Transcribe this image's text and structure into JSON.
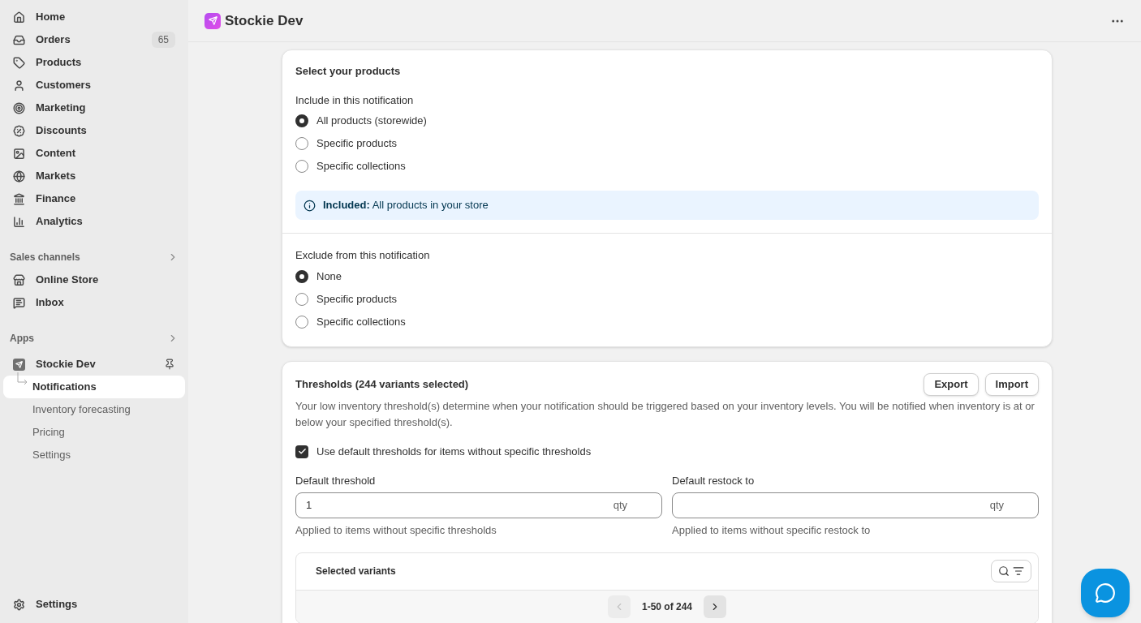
{
  "sidebar": {
    "items": [
      {
        "label": "Home",
        "selected": false
      },
      {
        "label": "Orders",
        "badge": "65",
        "selected": false
      },
      {
        "label": "Products",
        "selected": false
      },
      {
        "label": "Customers",
        "selected": false
      },
      {
        "label": "Marketing",
        "selected": false
      },
      {
        "label": "Discounts",
        "selected": false
      },
      {
        "label": "Content",
        "selected": false
      },
      {
        "label": "Markets",
        "selected": false
      },
      {
        "label": "Finance",
        "selected": false
      },
      {
        "label": "Analytics",
        "selected": false
      }
    ],
    "sales_channels": {
      "heading": "Sales channels",
      "items": [
        {
          "label": "Online Store",
          "selected": false
        },
        {
          "label": "Inbox",
          "selected": false
        }
      ]
    },
    "apps": {
      "heading": "Apps",
      "app": {
        "label": "Stockie Dev",
        "children": [
          {
            "label": "Notifications",
            "selected": true
          },
          {
            "label": "Inventory forecasting",
            "selected": false
          },
          {
            "label": "Pricing",
            "selected": false
          },
          {
            "label": "Settings",
            "selected": false
          }
        ]
      }
    },
    "settings": "Settings"
  },
  "header": {
    "title": "Stockie Dev"
  },
  "products_card": {
    "title": "Select your products",
    "include": {
      "label": "Include in this notification",
      "options": [
        {
          "label": "All products (storewide)",
          "selected": true
        },
        {
          "label": "Specific products",
          "selected": false
        },
        {
          "label": "Specific collections",
          "selected": false
        }
      ]
    },
    "banner": "**Included:** All products in your store",
    "exclude": {
      "label": "Exclude from this notification",
      "options": [
        {
          "label": "None",
          "selected": true
        },
        {
          "label": "Specific products",
          "selected": false
        },
        {
          "label": "Specific collections",
          "selected": false
        }
      ]
    }
  },
  "thresholds_card": {
    "title": "Thresholds (244 variants selected)",
    "buttons": [
      "Export",
      "Import"
    ],
    "description": "Your low inventory threshold(s) determine when your notification should be triggered based on your inventory levels. You will be notified when inventory is at or below your specified threshold(s).",
    "use_default": {
      "label": "Use default thresholds for items without specific thresholds",
      "checked": true
    },
    "fields": [
      {
        "label": "Default threshold",
        "value": "1",
        "suffix": "qty",
        "help": "Applied to items without specific thresholds"
      },
      {
        "label": "Default restock to",
        "suffix": "qty",
        "help": "Applied to items without specific restock to"
      }
    ],
    "variants": {
      "title": "Selected variants",
      "pagination": "1-50 of 244",
      "prev_disabled": true,
      "next_disabled": false
    }
  }
}
